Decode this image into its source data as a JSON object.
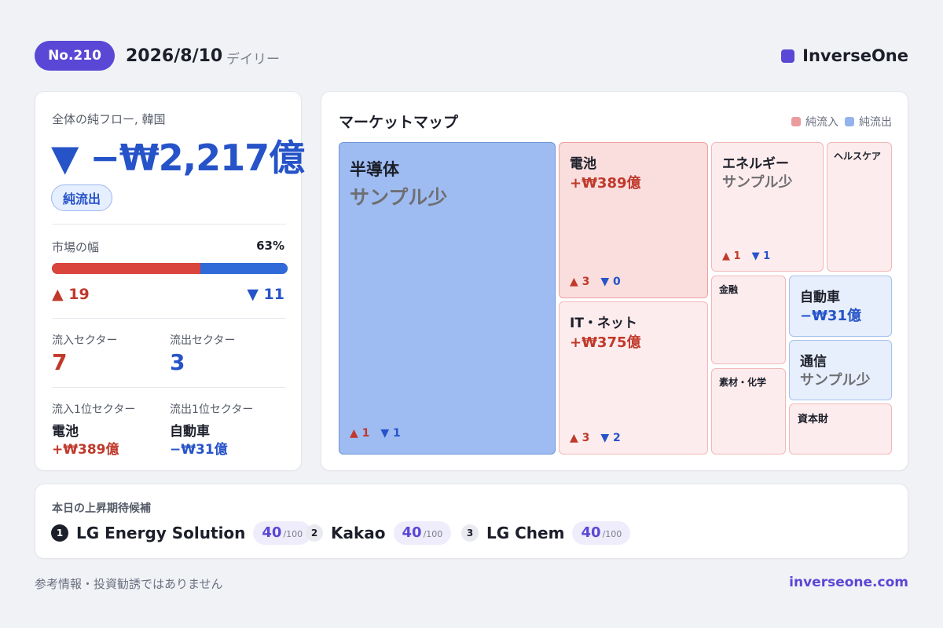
{
  "header": {
    "number": "No.210",
    "date": "2026/8/10",
    "kind": "デイリー",
    "brand": "InverseOne"
  },
  "summary": {
    "title": "全体の純フロー, 韓国",
    "flow": "▼ −₩2,217億",
    "badge": "純流出",
    "breadth_label": "市場の幅",
    "breadth_pct": "63%",
    "breadth_fraction": 0.63,
    "advancers": "▲ 19",
    "decliners": "▼ 11",
    "inflow_sectors_label": "流入セクター",
    "inflow_sectors": "7",
    "outflow_sectors_label": "流出セクター",
    "outflow_sectors": "3",
    "top_inflow_label": "流入1位セクター",
    "top_inflow_name": "電池",
    "top_inflow_amount": "+₩389億",
    "top_outflow_label": "流出1位セクター",
    "top_outflow_name": "自動車",
    "top_outflow_amount": "−₩31億"
  },
  "market_map": {
    "title": "マーケットマップ",
    "legend": {
      "inflow": "純流入",
      "outflow": "純流出"
    },
    "colors": {
      "inflow": "#ea9c9c",
      "outflow": "#93b3ec"
    },
    "tiles": {
      "semis": {
        "name": "半導体",
        "value": "サンプル少",
        "up": "▲ 1",
        "down": "▼ 1"
      },
      "battery": {
        "name": "電池",
        "value": "+₩389億",
        "up": "▲ 3",
        "down": "▼ 0"
      },
      "it": {
        "name": "IT・ネット",
        "value": "+₩375億",
        "up": "▲ 3",
        "down": "▼ 2"
      },
      "energy": {
        "name": "エネルギー",
        "value": "サンプル少",
        "up": "▲ 1",
        "down": "▼ 1"
      },
      "health": {
        "name": "ヘルスケア"
      },
      "finance": {
        "name": "金融"
      },
      "auto": {
        "name": "自動車",
        "value": "−₩31億"
      },
      "telecom": {
        "name": "通信",
        "value": "サンプル少"
      },
      "materials": {
        "name": "素材・化学"
      },
      "capital": {
        "name": "資本財"
      }
    }
  },
  "candidates": {
    "title": "本日の上昇期待候補",
    "items": [
      {
        "rank": "1",
        "name": "LG Energy Solution",
        "score": "40",
        "max": "/100"
      },
      {
        "rank": "2",
        "name": "Kakao",
        "score": "40",
        "max": "/100"
      },
      {
        "rank": "3",
        "name": "LG Chem",
        "score": "40",
        "max": "/100"
      }
    ]
  },
  "footer": {
    "disclaimer": "参考情報・投資勧誘ではありません",
    "site": "inverseone.com"
  }
}
